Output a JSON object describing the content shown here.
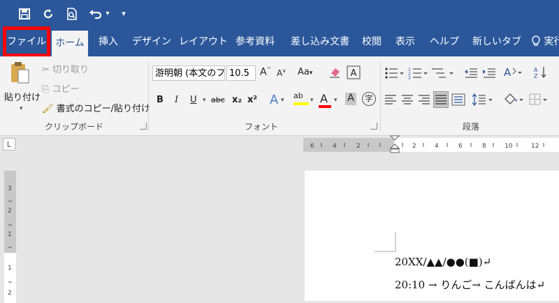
{
  "qat": {
    "customize_label": "▾"
  },
  "tabs": [
    {
      "label": "ファイル"
    },
    {
      "label": "ホーム"
    },
    {
      "label": "挿入"
    },
    {
      "label": "デザイン"
    },
    {
      "label": "レイアウト"
    },
    {
      "label": "参考資料"
    },
    {
      "label": "差し込み文書"
    },
    {
      "label": "校閲"
    },
    {
      "label": "表示"
    },
    {
      "label": "ヘルプ"
    },
    {
      "label": "新しいタブ"
    },
    {
      "label": "実行"
    }
  ],
  "clipboard": {
    "paste_label": "貼り付け",
    "cut_label": "切り取り",
    "copy_label": "コピー",
    "format_painter_label": "書式のコピー/貼り付け",
    "group_label": "クリップボード"
  },
  "font": {
    "font_name": "游明朝 (本文のフォント",
    "font_size": "10.5",
    "grow_label": "A",
    "shrink_label": "A",
    "case_label": "Aa",
    "bold": "B",
    "italic": "I",
    "underline": "U",
    "strike": "abc",
    "subscript": "x₂",
    "superscript": "x²",
    "effects": "A",
    "highlight": "ab",
    "font_color": "A",
    "shade": "A",
    "enclose": "字",
    "group_label": "フォント",
    "colors": {
      "font_color": "#ff0000",
      "highlight": "#ffff00"
    }
  },
  "paragraph": {
    "group_label": "段落"
  },
  "ruler": {
    "corner": "L",
    "h_ticks": [
      "6",
      "4",
      "2",
      "2",
      "4",
      "6",
      "8",
      "10",
      "12"
    ],
    "v_ticks": [
      "3",
      "2",
      "1",
      "1",
      "2"
    ]
  },
  "document": {
    "line1": "20XX/▲▲/●●(■)↵",
    "line2": "20:10 → りんご→ こんばんは↵"
  },
  "colors": {
    "brand": "#2b579a",
    "highlight_border": "#ff0000"
  }
}
